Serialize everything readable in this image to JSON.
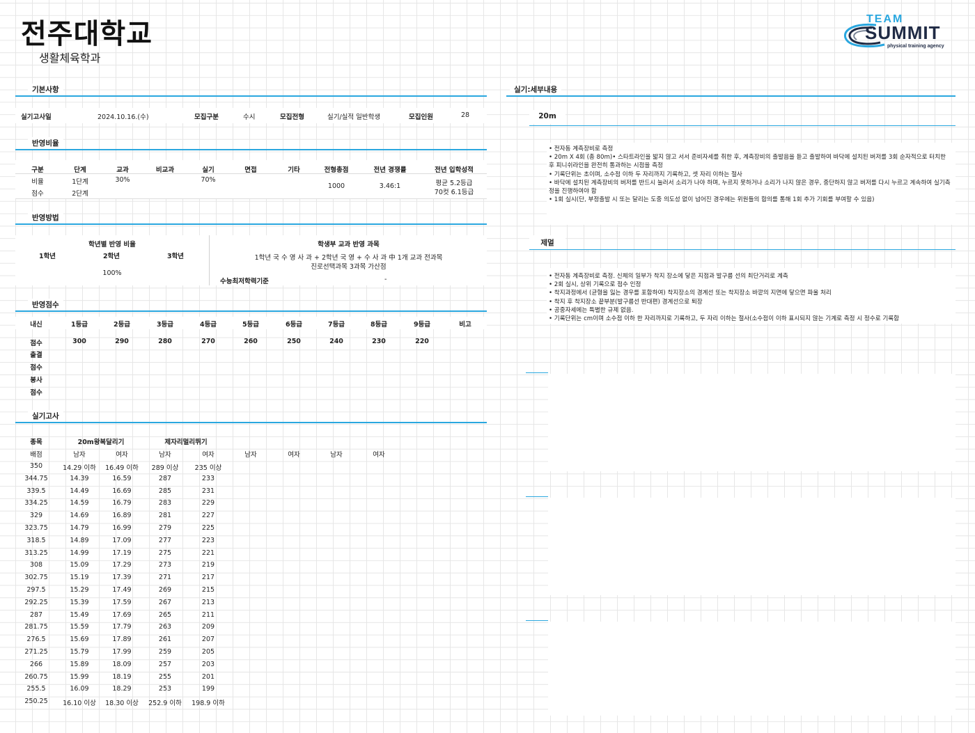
{
  "header": {
    "title": "전주대학교",
    "subtitle": "생활체육학과"
  },
  "logo": {
    "line1": "TEAM",
    "line2": "SUMMIT",
    "line3": "physical training agency"
  },
  "basic": {
    "section": "기본사항",
    "exam_date_label": "실기고사일",
    "exam_date": "2024.10.16.(수)",
    "recruit_type_label": "모집구분",
    "recruit_type": "수시",
    "recruit_track_label": "모집전형",
    "recruit_track": "실기/실적 일반학생",
    "recruit_count_label": "모집인원",
    "recruit_count": "28"
  },
  "ratio": {
    "section": "반영비율",
    "headers": [
      "구분",
      "단계",
      "교과",
      "비교과",
      "실기",
      "면접",
      "기타",
      "전형총점",
      "전년 경쟁률",
      "전년 입학성적"
    ],
    "row1": {
      "label": "비율",
      "stage": "1단계",
      "gyogwa": "30%",
      "silgi": "70%"
    },
    "row2": {
      "label": "점수",
      "stage": "2단계"
    },
    "total": "1000",
    "competition": "3.46:1",
    "admit1": "평균 5.2등급",
    "admit2": "70컷 6.1등급"
  },
  "method": {
    "section": "반영방법",
    "grade_ratio_title": "학년별 반영 비율",
    "grades": [
      "1학년",
      "2학년",
      "3학년"
    ],
    "grade_ratio": "100%",
    "subject_title": "학생부 교과 반영 과목",
    "subject_line1": "1학년 국 수 영 사 과 + 2학년 국 영 + 수 사 과 中 1개 교과 전과목",
    "subject_line2": "진로선택과목 3과목 가산점",
    "csat_label": "수능최저학력기준",
    "csat_value": "-"
  },
  "score": {
    "section": "반영점수",
    "headers": [
      "내신",
      "1등급",
      "2등급",
      "3등급",
      "4등급",
      "5등급",
      "6등급",
      "7등급",
      "8등급",
      "9등급",
      "비고"
    ],
    "row_label": "점수",
    "values": [
      "300",
      "290",
      "280",
      "270",
      "260",
      "250",
      "240",
      "230",
      "220"
    ],
    "extra_labels": [
      "출결",
      "점수",
      "봉사",
      "점수"
    ]
  },
  "practical": {
    "section": "실기고사",
    "item_label": "종목",
    "event1": "20m왕복달리기",
    "event2": "제자리멀리뛰기",
    "score_label": "배점",
    "gender": [
      "남자",
      "여자",
      "남자",
      "여자",
      "남자",
      "여자",
      "남자",
      "여자"
    ],
    "rows": [
      [
        "350",
        "14.29 이하",
        "16.49 이하",
        "289 이상",
        "235 이상"
      ],
      [
        "344.75",
        "14.39",
        "16.59",
        "287",
        "233"
      ],
      [
        "339.5",
        "14.49",
        "16.69",
        "285",
        "231"
      ],
      [
        "334.25",
        "14.59",
        "16.79",
        "283",
        "229"
      ],
      [
        "329",
        "14.69",
        "16.89",
        "281",
        "227"
      ],
      [
        "323.75",
        "14.79",
        "16.99",
        "279",
        "225"
      ],
      [
        "318.5",
        "14.89",
        "17.09",
        "277",
        "223"
      ],
      [
        "313.25",
        "14.99",
        "17.19",
        "275",
        "221"
      ],
      [
        "308",
        "15.09",
        "17.29",
        "273",
        "219"
      ],
      [
        "302.75",
        "15.19",
        "17.39",
        "271",
        "217"
      ],
      [
        "297.5",
        "15.29",
        "17.49",
        "269",
        "215"
      ],
      [
        "292.25",
        "15.39",
        "17.59",
        "267",
        "213"
      ],
      [
        "287",
        "15.49",
        "17.69",
        "265",
        "211"
      ],
      [
        "281.75",
        "15.59",
        "17.79",
        "263",
        "209"
      ],
      [
        "276.5",
        "15.69",
        "17.89",
        "261",
        "207"
      ],
      [
        "271.25",
        "15.79",
        "17.99",
        "259",
        "205"
      ],
      [
        "266",
        "15.89",
        "18.09",
        "257",
        "203"
      ],
      [
        "260.75",
        "15.99",
        "18.19",
        "255",
        "201"
      ],
      [
        "255.5",
        "16.09",
        "18.29",
        "253",
        "199"
      ],
      [
        "250.25",
        "16.10 이상",
        "18.30 이상",
        "252.9 이하",
        "198.9 이하"
      ]
    ]
  },
  "detail": {
    "section": "실기:세부내용",
    "event1": "20m",
    "notes1": [
      "• 전자동 계측장비로 측정",
      "• 20m X 4회 (총 80m)• 스타트라인을 밟지 않고 서서 준비자세를 취한 후, 계측장비의 출발음을 듣고 출발하여 바닥에 설치된 버저를 3회 순자적으로 터치한 후 피니쉬라인을 완전히 통과하는 시점을 측정",
      "• 기록단위는 초이며, 소수점 이하 두 자리까지 기록하고, 셋 자리 이하는 절사",
      "• 바닥에 설치된 계측장비의 버저를 반드시 눌러서 소리가 나야 하며, 누르지 못하거나 소리가 나지 않은 경우, 중단하지 않고 버저를 다시 누르고 계속하여 실기측정을 진행하여야 함",
      "• 1회 실시(단, 부정출발 시 또는 달리는 도중 의도성 없이 넘어진 경우에는 위원들의 합의를 통해 1회 추가 기회를 부여할 수 있음)"
    ],
    "event2": "제멀",
    "notes2": [
      "• 전자동 계측장비로 측정. 신체의 일부가 착지 장소에 닿은 지점과 발구름 선의 최단거리로 계측",
      "• 2회 실시, 상위 기록으로 점수 인정",
      "• 착지과정에서 (균형을 잃는 경우를 포함하여) 착지장소의 경계선 또는 착지장소 바깥의 지면에 닿으면 파울 처리",
      "• 착지 후 착지장소 끝부분(발구름선 반대편) 경계선으로 퇴장",
      "• 공중자세에는 특별한 규제 없음.",
      "• 기록단위는 cm이며 소수점 이하 한 자리까지로 기록하고, 두 자리 이하는 절사(소수점이 이하 표시되지 않는 기계로 측정 시 정수로 기록함"
    ]
  }
}
